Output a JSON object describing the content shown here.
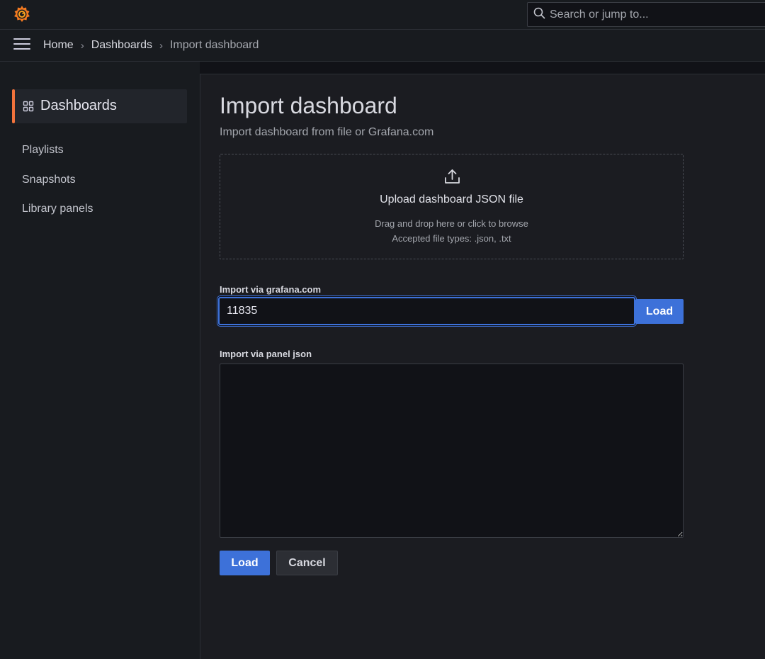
{
  "topbar": {
    "logo_icon": "grafana-logo-icon",
    "search": {
      "placeholder": "Search or jump to...",
      "icon": "search-icon"
    }
  },
  "breadcrumb": {
    "menu_icon": "hamburger-menu-icon",
    "items": [
      "Home",
      "Dashboards",
      "Import dashboard"
    ],
    "separator": "›"
  },
  "sidebar": {
    "active": {
      "label": "Dashboards",
      "icon": "apps-grid-icon",
      "accent": "#f2733c"
    },
    "items": [
      "Playlists",
      "Snapshots",
      "Library panels"
    ]
  },
  "main": {
    "title": "Import dashboard",
    "subtitle": "Import dashboard from file or Grafana.com",
    "upload": {
      "icon": "upload-icon",
      "title": "Upload dashboard JSON file",
      "line1": "Drag and drop here or click to browse",
      "line2": "Accepted file types: .json, .txt"
    },
    "grafana_com": {
      "label": "Import via grafana.com",
      "value": "11835",
      "load_label": "Load"
    },
    "panel_json": {
      "label": "Import via panel json",
      "value": ""
    },
    "actions": {
      "load_label": "Load",
      "cancel_label": "Cancel"
    }
  },
  "colors": {
    "primary": "#3d71d9",
    "accent": "#f2733c",
    "background": "#111217"
  }
}
